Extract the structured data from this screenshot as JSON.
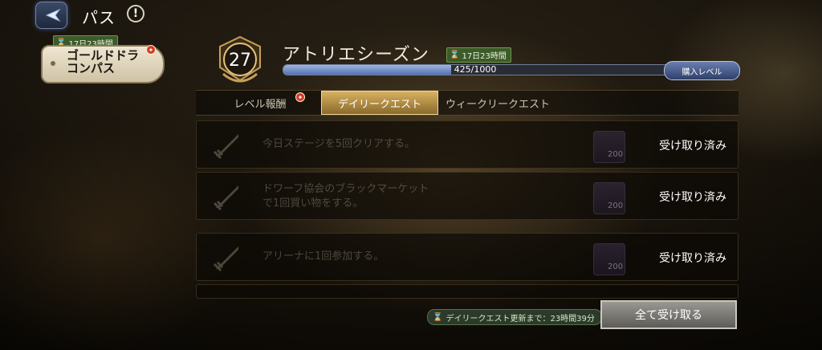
{
  "header": {
    "title": "パス",
    "info_icon": "!"
  },
  "pass_card": {
    "timer": "17日23時間",
    "name": "ゴールドドラコンパス"
  },
  "season": {
    "level": "27",
    "title": "アトリエシーズン",
    "timer": "17日23時間",
    "xp_text": "425/1000",
    "xp_fraction": 0.425,
    "buy_level_label": "購入レベル"
  },
  "tabs": [
    {
      "label": "レベル報酬"
    },
    {
      "label": "デイリークエスト"
    },
    {
      "label": "ウィークリークエスト"
    }
  ],
  "quests": [
    {
      "text_line1": "今日ステージを5回クリアする。",
      "text_line2": "",
      "reward": "200",
      "status": "受け取り済み"
    },
    {
      "text_line1": "ドワーフ協会のブラックマーケット",
      "text_line2": "で1回買い物をする。",
      "reward": "200",
      "status": "受け取り済み"
    },
    {
      "text_line1": "アリーナに1回参加する。",
      "text_line2": "",
      "reward": "200",
      "status": "受け取り済み"
    }
  ],
  "footer": {
    "refresh_text": "デイリークエスト更新まで：23時間39分",
    "claim_all_label": "全て受け取る"
  },
  "colors": {
    "accent_gold": "#d8b060",
    "timer_green": "#3c5a2a",
    "xp_blue": "#5572b0"
  }
}
